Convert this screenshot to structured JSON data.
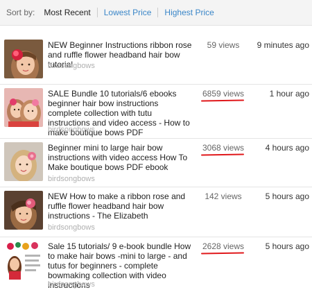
{
  "sort": {
    "label": "Sort by:",
    "options": [
      "Most Recent",
      "Lowest Price",
      "Highest Price"
    ]
  },
  "listings": [
    {
      "title": "NEW Beginner Instructions ribbon rose and ruffle flower headband hair bow tutorial",
      "shop": "birdsongbows",
      "views": "59 views",
      "time": "9 minutes ago",
      "views_marked": false
    },
    {
      "title": "SALE Bundle 10 tutorials/6 ebooks beginner hair bow instructions complete collection with tutu instructions and video access - How to make boutique bows PDF",
      "shop": "birdsongbows",
      "views": "6859 views",
      "time": "1 hour ago",
      "views_marked": true
    },
    {
      "title": "Beginner mini to large hair bow instructions with video access How To Make boutique bows PDF ebook",
      "shop": "birdsongbows",
      "views": "3068 views",
      "time": "4 hours ago",
      "views_marked": true
    },
    {
      "title": "NEW How to make a ribbon rose and ruffle flower headband hair bow instructions - The Elizabeth",
      "shop": "birdsongbows",
      "views": "142 views",
      "time": "5 hours ago",
      "views_marked": false
    },
    {
      "title": "Sale 15 tutorials/ 9 e-book bundle How to make hair bows -mini to large - and tutus for beginners - complete bowmaking collection with video instructions",
      "shop": "birdsongbows",
      "views": "2628 views",
      "time": "5 hours ago",
      "views_marked": true
    }
  ],
  "colors": {
    "link": "#3a86c8",
    "annotation_underline": "#e0181b",
    "shop_text": "#b0b0b0"
  }
}
